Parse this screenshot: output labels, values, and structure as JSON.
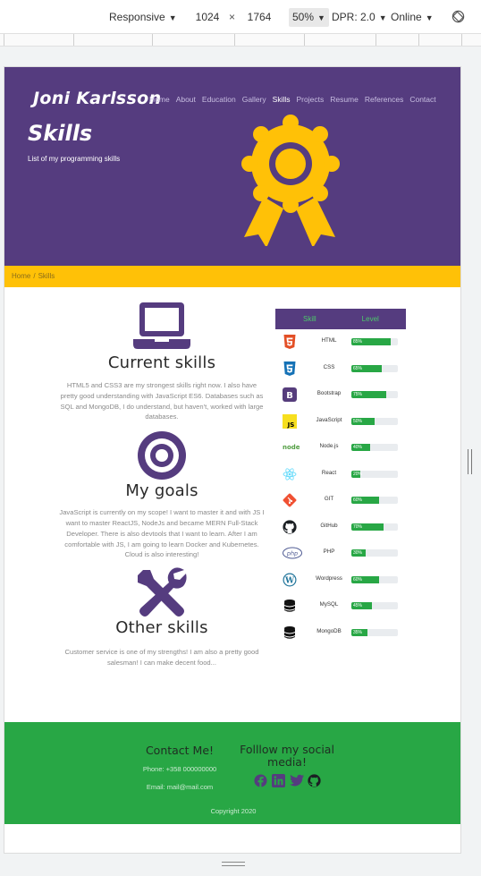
{
  "devtools": {
    "device": "Responsive",
    "width": "1024",
    "times": "×",
    "height": "1764",
    "zoom": "50%",
    "dpr": "DPR: 2.0",
    "network": "Online"
  },
  "site": {
    "brand": "Joni Karlsson",
    "nav": [
      "Home",
      "About",
      "Education",
      "Gallery",
      "Skills",
      "Projects",
      "Resume",
      "References",
      "Contact"
    ],
    "active_nav": "Skills",
    "hero_title": "Skills",
    "hero_subtitle": "List of my programming skills",
    "breadcrumb": {
      "home": "Home",
      "sep": "/",
      "current": "Skills"
    }
  },
  "sections": [
    {
      "icon": "laptop-icon",
      "title": "Current skills",
      "text": "HTML5 and CSS3 are my strongest skills right now. I also have pretty good understanding with JavaScript ES6. Databases such as SQL and MongoDB, I do understand, but haven't, worked with large databases."
    },
    {
      "icon": "target-icon",
      "title": "My goals",
      "text": "JavaScript is currently on my scope! I want to master it and with JS I want to master ReactJS, NodeJs and became MERN Full-Stack Developer. There is also devtools that I want to learn. After I am comfortable with JS, I am going to learn Docker and Kubernetes. Cloud is also interesting!"
    },
    {
      "icon": "tools-icon",
      "title": "Other skills",
      "text": "Customer service is one of my strengths! I am also a pretty good salesman! I can make decent food..."
    }
  ],
  "skills_table": {
    "header_skill": "Skill",
    "header_level": "Level",
    "rows": [
      {
        "icon": "html5-icon",
        "name": "HTML",
        "level": 85,
        "label": "85%"
      },
      {
        "icon": "css3-icon",
        "name": "CSS",
        "level": 65,
        "label": "65%"
      },
      {
        "icon": "bootstrap-icon",
        "name": "Bootstrap",
        "level": 75,
        "label": "75%"
      },
      {
        "icon": "javascript-icon",
        "name": "JavaScript",
        "level": 50,
        "label": "50%"
      },
      {
        "icon": "nodejs-icon",
        "name": "Node.js",
        "level": 40,
        "label": "40%"
      },
      {
        "icon": "react-icon",
        "name": "React",
        "level": 20,
        "label": "20%"
      },
      {
        "icon": "git-icon",
        "name": "GIT",
        "level": 60,
        "label": "60%"
      },
      {
        "icon": "github-icon",
        "name": "GitHub",
        "level": 70,
        "label": "70%"
      },
      {
        "icon": "php-icon",
        "name": "PHP",
        "level": 30,
        "label": "30%"
      },
      {
        "icon": "wordpress-icon",
        "name": "Wordpress",
        "level": 60,
        "label": "60%"
      },
      {
        "icon": "mysql-icon",
        "name": "MySQL",
        "level": 45,
        "label": "45%"
      },
      {
        "icon": "mongodb-icon",
        "name": "MongoDB",
        "level": 35,
        "label": "35%"
      }
    ]
  },
  "footer": {
    "contact_title": "Contact Me!",
    "phone": "Phone: +358 000000000",
    "email": "Email: mail@mail.com",
    "social_title": "Folllow my social media!",
    "social_icons": [
      "facebook-icon",
      "linkedin-icon",
      "twitter-icon",
      "github-icon"
    ],
    "copyright": "Copyright 2020"
  },
  "colors": {
    "primary": "#553c7f",
    "accent": "#ffc107",
    "success": "#28a745"
  }
}
